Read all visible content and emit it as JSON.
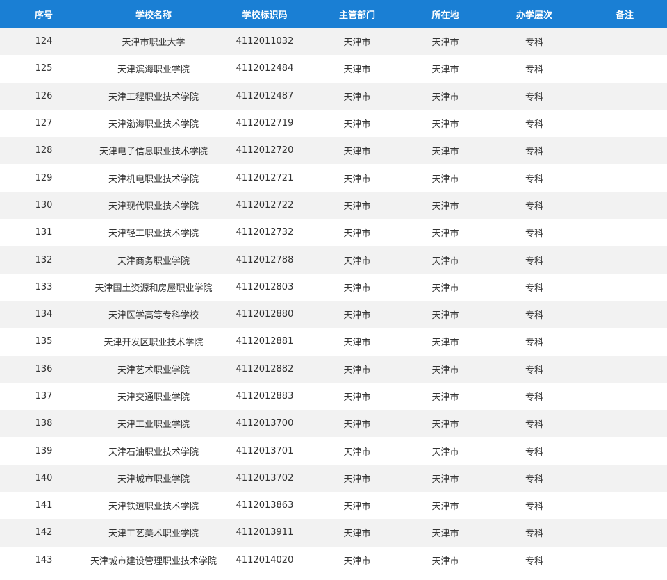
{
  "colors": {
    "header_bg": "#1a7fd4",
    "header_text": "#ffffff",
    "row_alt_bg": "#f2f2f2",
    "row_bg": "#ffffff",
    "text": "#333333"
  },
  "table": {
    "headers": [
      "序号",
      "学校名称",
      "学校标识码",
      "主管部门",
      "所在地",
      "办学层次",
      "备注"
    ],
    "rows": [
      [
        "124",
        "天津市职业大学",
        "4112011032",
        "天津市",
        "天津市",
        "专科",
        ""
      ],
      [
        "125",
        "天津滨海职业学院",
        "4112012484",
        "天津市",
        "天津市",
        "专科",
        ""
      ],
      [
        "126",
        "天津工程职业技术学院",
        "4112012487",
        "天津市",
        "天津市",
        "专科",
        ""
      ],
      [
        "127",
        "天津渤海职业技术学院",
        "4112012719",
        "天津市",
        "天津市",
        "专科",
        ""
      ],
      [
        "128",
        "天津电子信息职业技术学院",
        "4112012720",
        "天津市",
        "天津市",
        "专科",
        ""
      ],
      [
        "129",
        "天津机电职业技术学院",
        "4112012721",
        "天津市",
        "天津市",
        "专科",
        ""
      ],
      [
        "130",
        "天津现代职业技术学院",
        "4112012722",
        "天津市",
        "天津市",
        "专科",
        ""
      ],
      [
        "131",
        "天津轻工职业技术学院",
        "4112012732",
        "天津市",
        "天津市",
        "专科",
        ""
      ],
      [
        "132",
        "天津商务职业学院",
        "4112012788",
        "天津市",
        "天津市",
        "专科",
        ""
      ],
      [
        "133",
        "天津国土资源和房屋职业学院",
        "4112012803",
        "天津市",
        "天津市",
        "专科",
        ""
      ],
      [
        "134",
        "天津医学高等专科学校",
        "4112012880",
        "天津市",
        "天津市",
        "专科",
        ""
      ],
      [
        "135",
        "天津开发区职业技术学院",
        "4112012881",
        "天津市",
        "天津市",
        "专科",
        ""
      ],
      [
        "136",
        "天津艺术职业学院",
        "4112012882",
        "天津市",
        "天津市",
        "专科",
        ""
      ],
      [
        "137",
        "天津交通职业学院",
        "4112012883",
        "天津市",
        "天津市",
        "专科",
        ""
      ],
      [
        "138",
        "天津工业职业学院",
        "4112013700",
        "天津市",
        "天津市",
        "专科",
        ""
      ],
      [
        "139",
        "天津石油职业技术学院",
        "4112013701",
        "天津市",
        "天津市",
        "专科",
        ""
      ],
      [
        "140",
        "天津城市职业学院",
        "4112013702",
        "天津市",
        "天津市",
        "专科",
        ""
      ],
      [
        "141",
        "天津铁道职业技术学院",
        "4112013863",
        "天津市",
        "天津市",
        "专科",
        ""
      ],
      [
        "142",
        "天津工艺美术职业学院",
        "4112013911",
        "天津市",
        "天津市",
        "专科",
        ""
      ],
      [
        "143",
        "天津城市建设管理职业技术学院",
        "4112014020",
        "天津市",
        "天津市",
        "专科",
        ""
      ]
    ]
  }
}
